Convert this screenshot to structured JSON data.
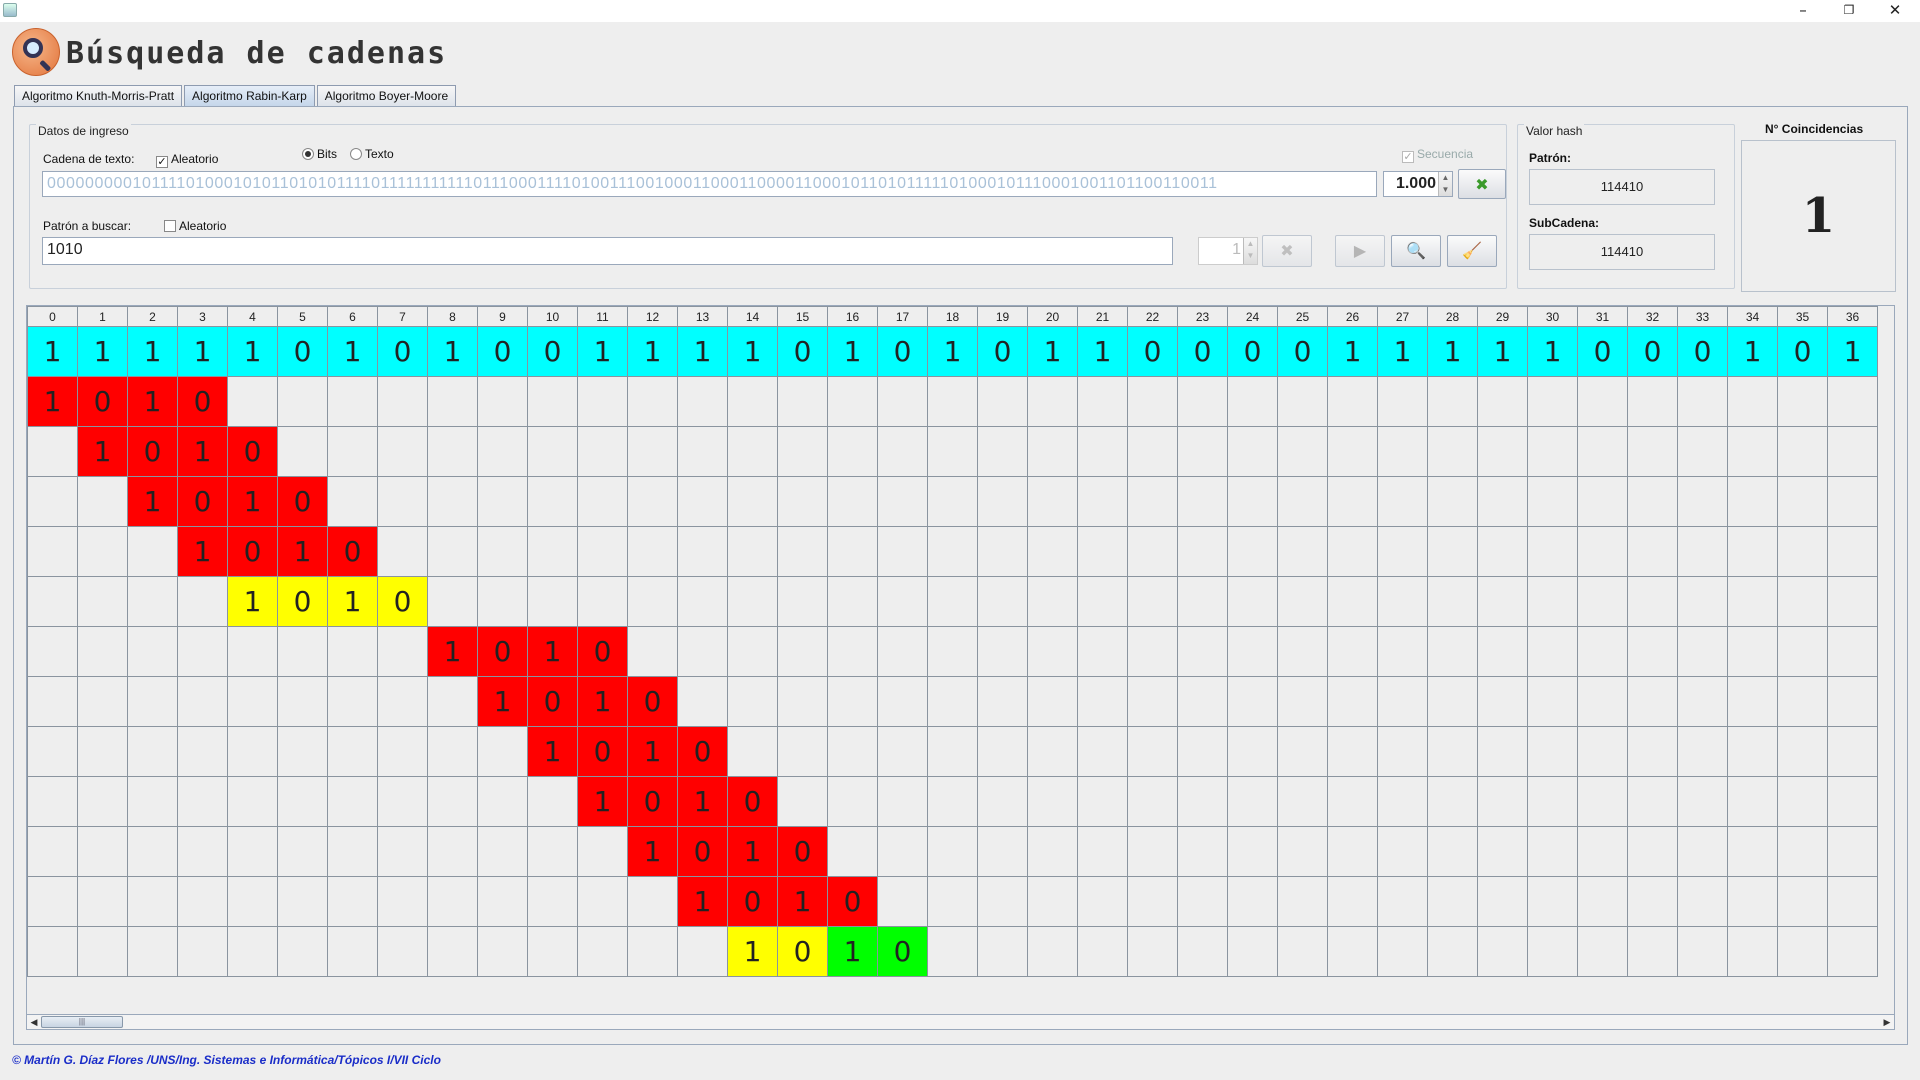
{
  "window": {
    "minimize": "–",
    "restore": "❐",
    "close": "✕"
  },
  "app": {
    "title": "Búsqueda de cadenas"
  },
  "tabs": [
    {
      "label": "Algoritmo Knuth-Morris-Pratt"
    },
    {
      "label": "Algoritmo Rabin-Karp"
    },
    {
      "label": "Algoritmo Boyer-Moore"
    }
  ],
  "ingreso": {
    "title": "Datos de ingreso",
    "cadena_label": "Cadena de texto:",
    "cadena_aleatorio": "Aleatorio",
    "bits_label": "Bits",
    "texto_label": "Texto",
    "secuencia_label": "Secuencia",
    "cadena_value": "00000000010111101000101011010101111011111111111011100011110100111001000110001100001100010110101111101000101110001001101100110011",
    "length_value": "1.000",
    "patron_label": "Patrón a buscar:",
    "patron_aleatorio": "Aleatorio",
    "patron_value": "1010",
    "patron_len": "1"
  },
  "hash": {
    "title": "Valor hash",
    "patron_label": "Patrón:",
    "patron_value": "114410",
    "subcadena_label": "SubCadena:",
    "subcadena_value": "114410"
  },
  "coincidencias": {
    "title": "N° Coincidencias",
    "value": "1"
  },
  "grid": {
    "text": [
      "1",
      "1",
      "1",
      "1",
      "1",
      "0",
      "1",
      "0",
      "1",
      "0",
      "0",
      "1",
      "1",
      "1",
      "1",
      "0",
      "1",
      "0",
      "1",
      "0",
      "1",
      "1",
      "0",
      "0",
      "0",
      "0",
      "1",
      "1",
      "1",
      "1",
      "1",
      "0",
      "0",
      "0",
      "1",
      "0",
      "1"
    ],
    "pattern": [
      "1",
      "0",
      "1",
      "0"
    ],
    "rows": [
      {
        "start": 0,
        "colors": [
          "red",
          "red",
          "red",
          "red"
        ]
      },
      {
        "start": 1,
        "colors": [
          "red",
          "red",
          "red",
          "red"
        ]
      },
      {
        "start": 2,
        "colors": [
          "red",
          "red",
          "red",
          "red"
        ]
      },
      {
        "start": 3,
        "colors": [
          "red",
          "red",
          "red",
          "red"
        ]
      },
      {
        "start": 4,
        "colors": [
          "yellow",
          "yellow",
          "yellow",
          "yellow"
        ]
      },
      {
        "start": 8,
        "colors": [
          "red",
          "red",
          "red",
          "red"
        ]
      },
      {
        "start": 9,
        "colors": [
          "red",
          "red",
          "red",
          "red"
        ]
      },
      {
        "start": 10,
        "colors": [
          "red",
          "red",
          "red",
          "red"
        ]
      },
      {
        "start": 11,
        "colors": [
          "red",
          "red",
          "red",
          "red"
        ]
      },
      {
        "start": 12,
        "colors": [
          "red",
          "red",
          "red",
          "red"
        ]
      },
      {
        "start": 13,
        "colors": [
          "red",
          "red",
          "red",
          "red"
        ]
      },
      {
        "start": 14,
        "colors": [
          "yellow",
          "yellow",
          "green",
          "green"
        ]
      }
    ]
  },
  "footer": "© Martín G. Díaz Flores /UNS/Ing. Sistemas e Informática/Tópicos I/VII Ciclo"
}
